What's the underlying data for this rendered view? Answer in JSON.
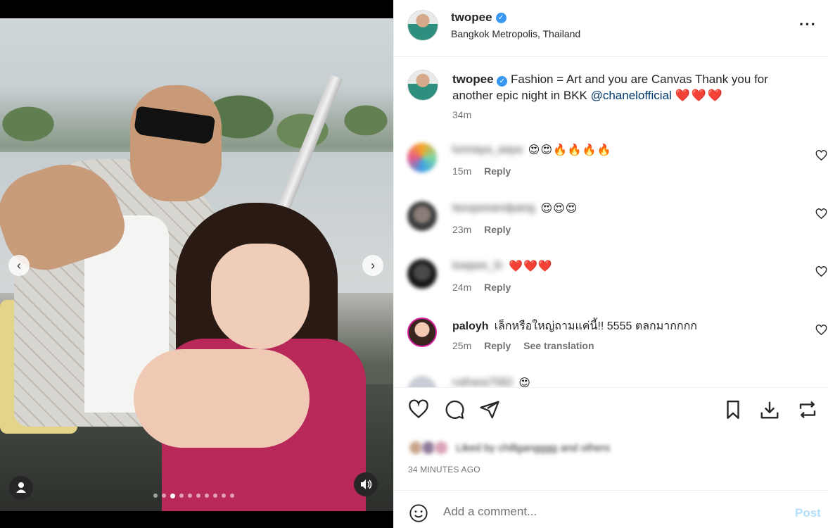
{
  "post": {
    "username": "twopee",
    "location": "Bangkok Metropolis, Thailand",
    "caption_text": "Fashion = Art and you are Canvas Thank you for another epic night in BKK ",
    "caption_mention": "@chanelofficial",
    "caption_hearts": "❤️❤️❤️",
    "caption_time": "34m"
  },
  "media": {
    "dot_count": 10,
    "active_dot_index": 2
  },
  "comments": [
    {
      "username": "lunnaya_aaya",
      "blurred": true,
      "text": "😍😍🔥🔥🔥🔥",
      "time": "15m",
      "reply_label": "Reply"
    },
    {
      "username": "lasspeeandpang",
      "blurred": true,
      "text": "😍😍😍",
      "time": "23m",
      "reply_label": "Reply"
    },
    {
      "username": "lowpee_fc",
      "blurred": true,
      "text": "❤️❤️❤️",
      "time": "24m",
      "reply_label": "Reply"
    },
    {
      "username": "paloyh",
      "blurred": false,
      "text": "เล็กหรือใหญ่ถามแค่นี้!! 5555 ตลกมากกกก",
      "time": "25m",
      "reply_label": "Reply",
      "translate_label": "See translation"
    }
  ],
  "partial_comment": {
    "username": "ruthara7582",
    "text": "😍"
  },
  "engagement": {
    "liked_by_text": "Liked by chillgangggg and others",
    "time_ago": "34 MINUTES AGO"
  },
  "composer": {
    "placeholder": "Add a comment...",
    "post_label": "Post"
  },
  "colors": {
    "verified": "#3897f0",
    "mention": "#00376b",
    "post_disabled": "#b2dffc",
    "heart": "#e0201f"
  }
}
